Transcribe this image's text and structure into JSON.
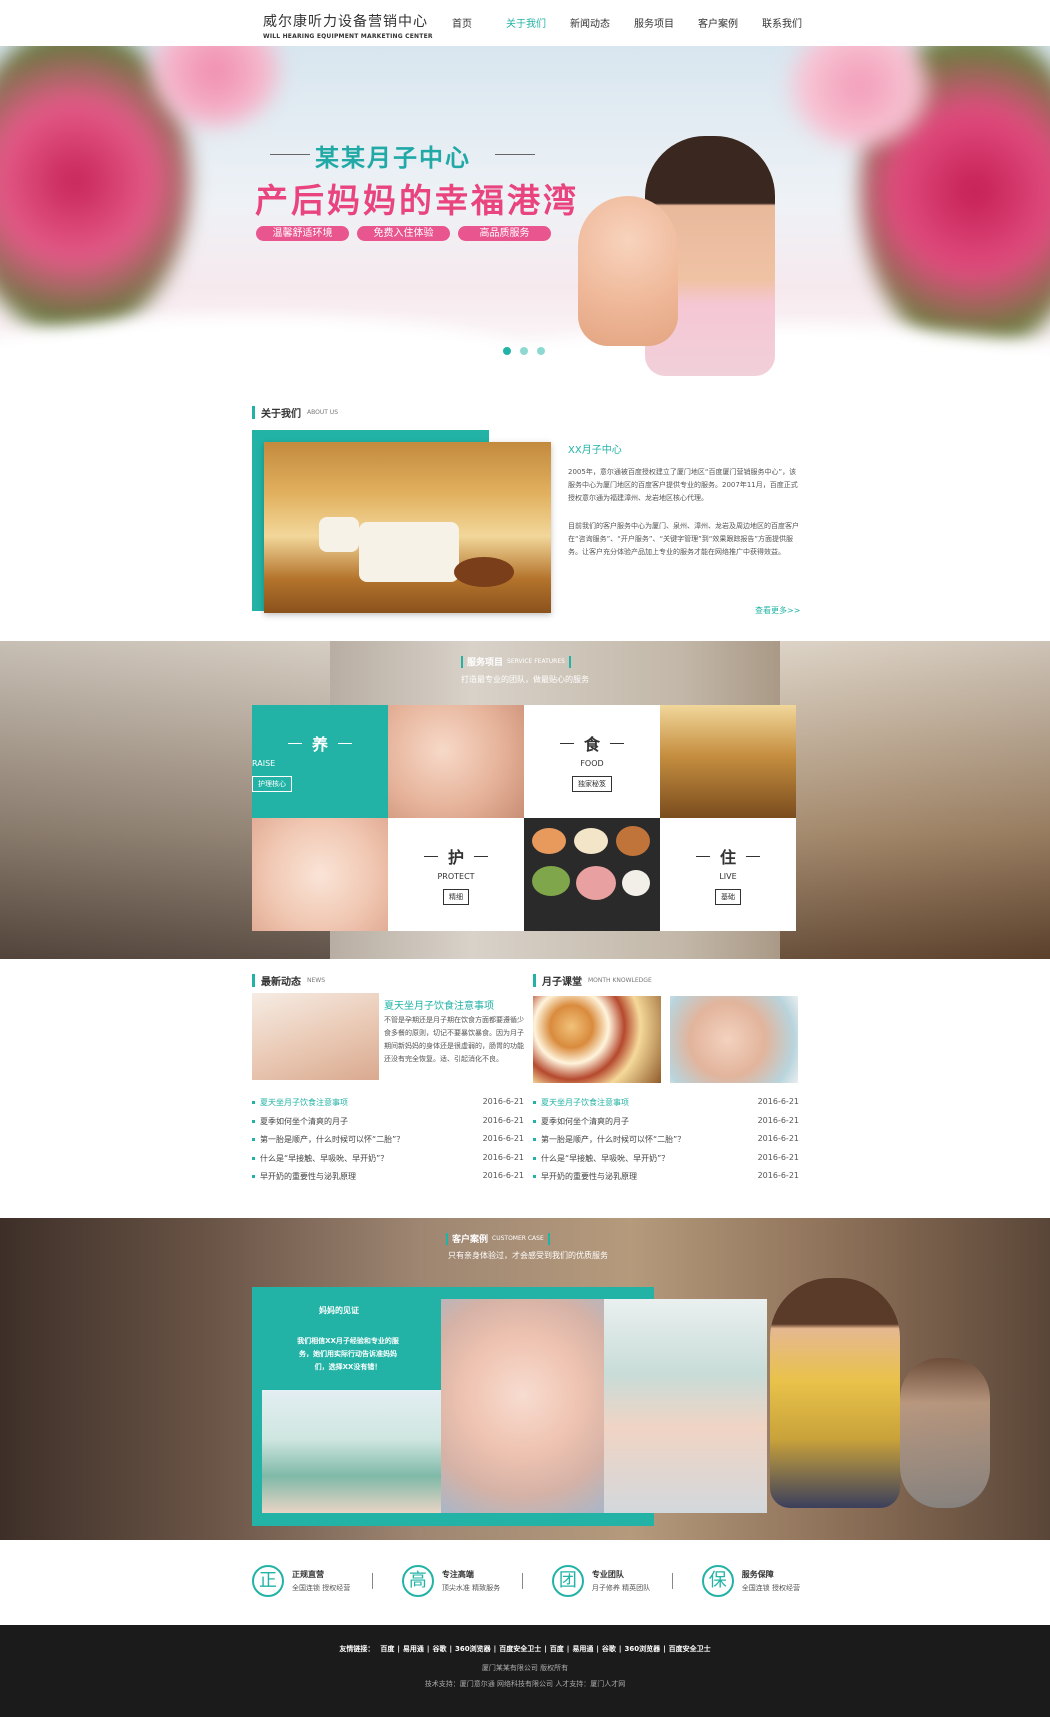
{
  "header": {
    "logo_cn": "威尔康听力设备营销中心",
    "logo_en": "WILL HEARING EQUIPMENT MARKETING CENTER",
    "nav": [
      "首页",
      "关于我们",
      "新闻动态",
      "服务项目",
      "客户案例",
      "联系我们"
    ],
    "active_index": 1
  },
  "hero": {
    "subtitle": "某某月子中心",
    "title": "产后妈妈的幸福港湾",
    "tags": [
      "温馨舒适环境",
      "免费入住体验",
      "高品质服务"
    ],
    "dots": 3,
    "active_dot": 0
  },
  "about": {
    "title_cn": "关于我们",
    "title_en": "ABOUT US",
    "heading": "XX月子中心",
    "para1": "2005年，意尔通被百度授权建立了厦门地区“百度厦门营销服务中心”，该服务中心为厦门地区的百度客户提供专业的服务。2007年11月，百度正式授权意尔通为福建漳州、龙岩地区核心代理。",
    "para2": "目前我们的客户服务中心为厦门、泉州、漳州、龙岩及周边地区的百度客户在“咨询服务”、“开户服务”、“关键字管理”到“效果跟踪报告”方面提供服务。让客户充分体验产品加上专业的服务才能在网络推广中获得效益。",
    "more": "查看更多>>"
  },
  "services": {
    "title_cn": "服务项目",
    "title_en": "SERVICE FEATURES",
    "subtitle": "打造最专业的团队，做最贴心的服务",
    "cells": [
      {
        "cn": "养",
        "en": "RAISE",
        "btn": "护理核心"
      },
      {
        "cn": "食",
        "en": "FOOD",
        "btn": "独家秘笈"
      },
      {
        "cn": "护",
        "en": "PROTECT",
        "btn": "精细"
      },
      {
        "cn": "住",
        "en": "LIVE",
        "btn": "基础"
      }
    ]
  },
  "news": {
    "title_cn": "最新动态",
    "title_en": "NEWS",
    "featured_title": "夏天坐月子饮食注意事项",
    "featured_text": "不管是孕期还是月子期在饮食方面都要遵循少食多餐的原则，切记不要暴饮暴食。因为月子期间新妈妈的身体还是很虚弱的，肠胃的功能还没有完全恢复。适、引起消化不良。",
    "items": [
      {
        "title": "夏天坐月子饮食注意事项",
        "date": "2016-6-21"
      },
      {
        "title": "夏季如何坐个清爽的月子",
        "date": "2016-6-21"
      },
      {
        "title": "第一胎是顺产，什么时候可以怀“二胎”？",
        "date": "2016-6-21"
      },
      {
        "title": "什么是“早接触、早吸吮、早开奶”？",
        "date": "2016-6-21"
      },
      {
        "title": "早开奶的重要性与泌乳原理",
        "date": "2016-6-21"
      }
    ]
  },
  "knowledge": {
    "title_cn": "月子课堂",
    "title_en": "MONTH  KNOWLEDGE",
    "items": [
      {
        "title": "夏天坐月子饮食注意事项",
        "date": "2016-6-21"
      },
      {
        "title": "夏季如何坐个清爽的月子",
        "date": "2016-6-21"
      },
      {
        "title": "第一胎是顺产，什么时候可以怀“二胎”？",
        "date": "2016-6-21"
      },
      {
        "title": "什么是“早接触、早吸吮、早开奶”？",
        "date": "2016-6-21"
      },
      {
        "title": "早开奶的重要性与泌乳原理",
        "date": "2016-6-21"
      }
    ]
  },
  "cases": {
    "title_cn": "客户案例",
    "title_en": "CUSTOMER CASE",
    "subtitle": "只有亲身体验过，才会感受到我们的优质服务",
    "box_title": "妈妈的见证",
    "box_text": "我们相信XX月子经验和专业的服务，她们用实际行动告诉准妈妈们，选择XX没有错！"
  },
  "features": [
    {
      "icon": "正",
      "title": "正规直营",
      "sub": "全国连锁 授权经营"
    },
    {
      "icon": "高",
      "title": "专注高端",
      "sub": "顶尖水准 精致服务"
    },
    {
      "icon": "团",
      "title": "专业团队",
      "sub": "月子修养 精英团队"
    },
    {
      "icon": "保",
      "title": "服务保障",
      "sub": "全国连锁 授权经营"
    }
  ],
  "footer": {
    "links_label": "友情链接：",
    "links": [
      "百度",
      "易用通",
      "谷歌",
      "360浏览器",
      "百度安全卫士",
      "百度",
      "易用通",
      "谷歌",
      "360浏览器",
      "百度安全卫士"
    ],
    "copyright": "厦门某某有限公司  版权所有",
    "support": "技术支持：厦门意尔通 网络科技有限公司 人才支持：厦门人才网"
  },
  "colors": {
    "accent": "#22b3a6",
    "pink": "#e9447d",
    "footer_bg": "#1b1b1b"
  }
}
